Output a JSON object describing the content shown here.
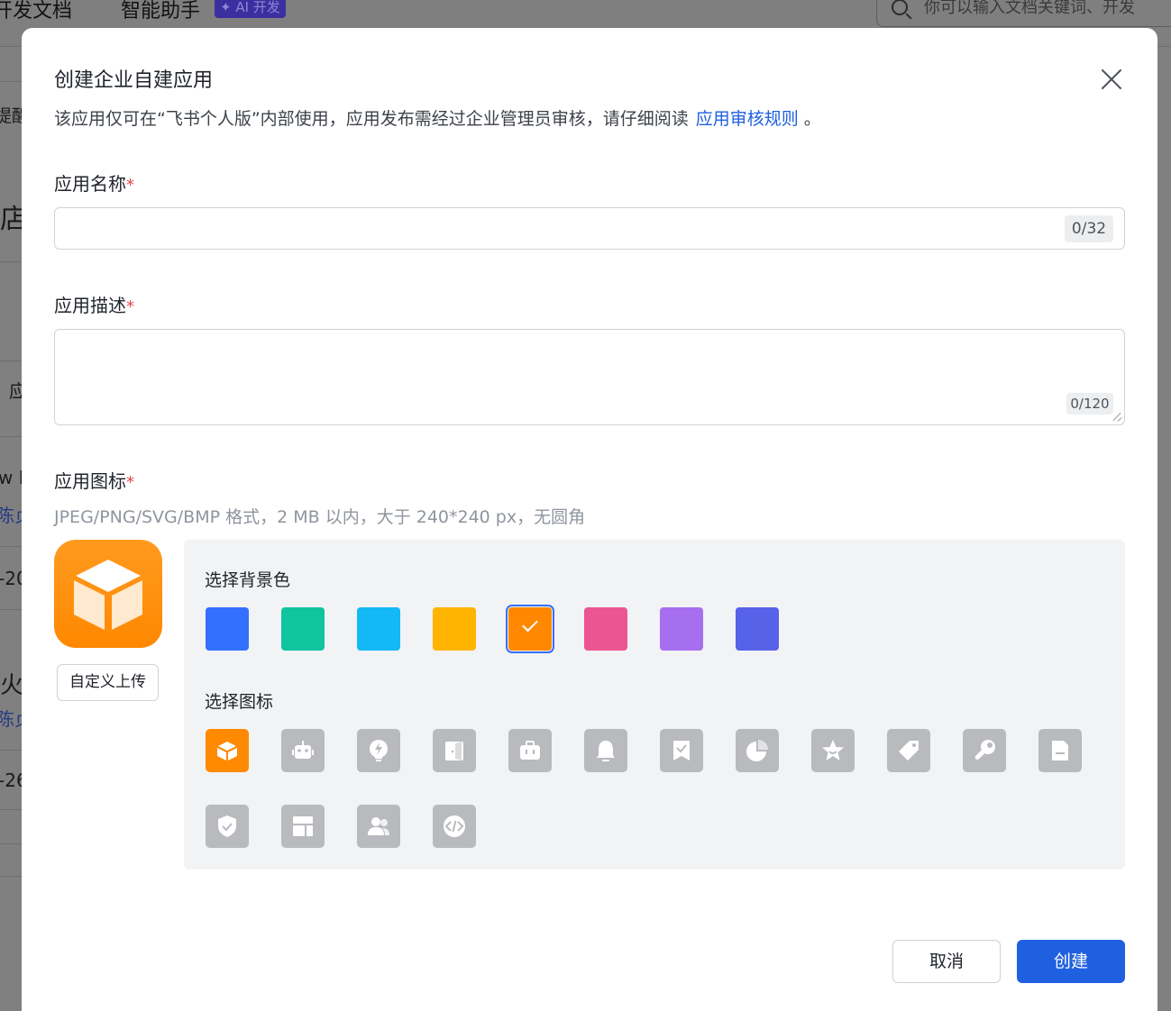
{
  "background": {
    "nav_items": [
      "开发文档",
      "智能助手"
    ],
    "ai_badge": "✦ AI 开发",
    "search_placeholder": "你可以输入文档关键词、开发",
    "fragments": [
      "提醒",
      "店",
      "应",
      "w I",
      "陈贞",
      "-20",
      "火",
      "陈贞",
      "-26"
    ]
  },
  "modal": {
    "title": "创建企业自建应用",
    "notice_text": "该应用仅可在“飞书个人版”内部使用，应用发布需经过企业管理员审核，请仔细阅读",
    "notice_link": "应用审核规则",
    "notice_end": "。",
    "name_field": {
      "label": "应用名称",
      "required_mark": "*",
      "value": "",
      "counter": "0/32"
    },
    "desc_field": {
      "label": "应用描述",
      "required_mark": "*",
      "value": "",
      "counter": "0/120"
    },
    "icon_field": {
      "label": "应用图标",
      "required_mark": "*",
      "hint": "JPEG/PNG/SVG/BMP 格式，2 MB 以内，大于 240*240 px，无圆角",
      "upload_button": "自定义上传"
    },
    "color_picker": {
      "label": "选择背景色",
      "colors": [
        {
          "name": "blue",
          "value": "#3370ff"
        },
        {
          "name": "teal",
          "value": "#10c4a0"
        },
        {
          "name": "cyan",
          "value": "#14b8f5"
        },
        {
          "name": "yellow",
          "value": "#ffb400"
        },
        {
          "name": "orange",
          "value": "#ff8800"
        },
        {
          "name": "pink",
          "value": "#eb5592"
        },
        {
          "name": "purple",
          "value": "#a66ff0"
        },
        {
          "name": "indigo",
          "value": "#5662e8"
        }
      ],
      "selected_index": 4
    },
    "icon_picker": {
      "label": "选择图标",
      "icons": [
        "cube-icon",
        "robot-icon",
        "lightbulb-icon",
        "door-icon",
        "briefcase-icon",
        "bell-icon",
        "bookmark-check-icon",
        "pie-chart-icon",
        "star-icon",
        "tag-icon",
        "wrench-icon",
        "document-icon",
        "shield-check-icon",
        "layout-icon",
        "users-icon",
        "code-icon"
      ],
      "selected_index": 0
    },
    "buttons": {
      "cancel": "取消",
      "create": "创建"
    }
  }
}
